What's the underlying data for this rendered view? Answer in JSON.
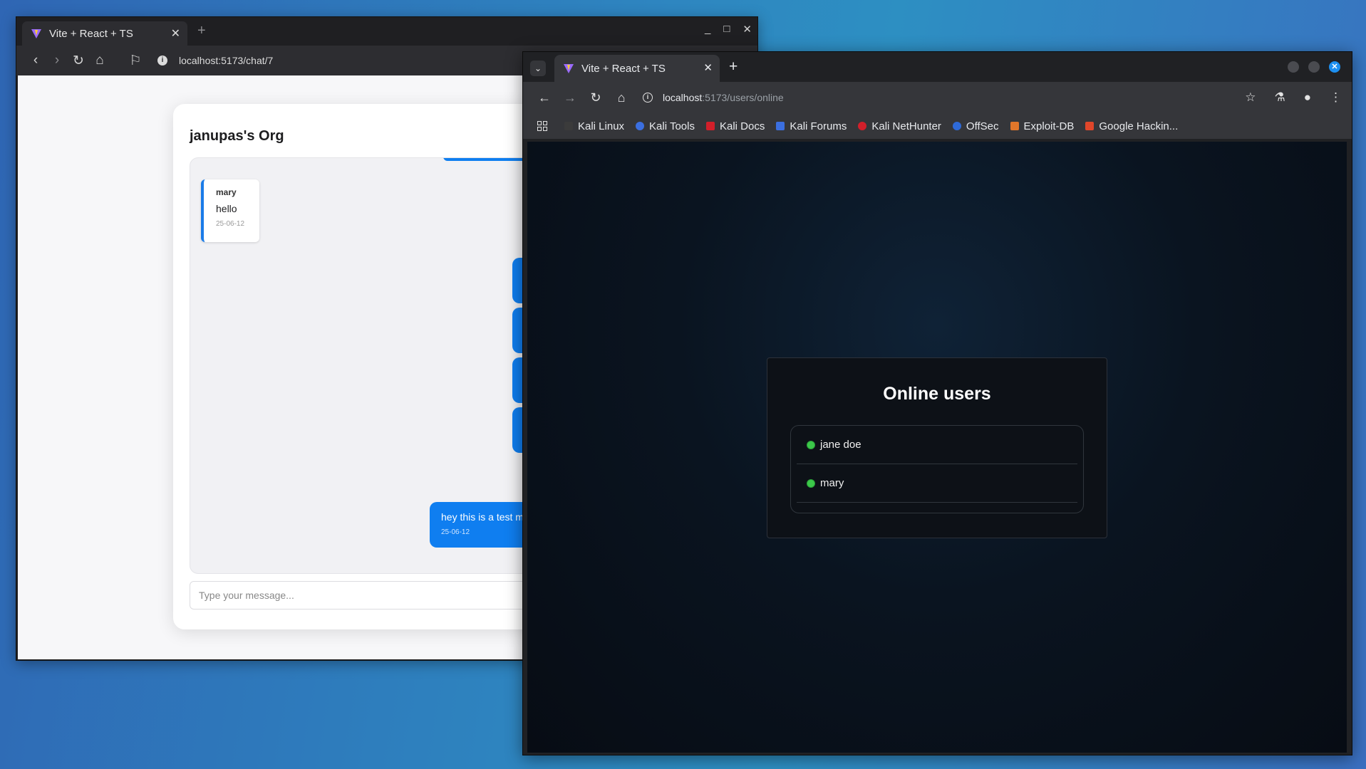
{
  "left_window": {
    "tab_title": "Vite + React + TS",
    "url": "localhost:5173/chat/7",
    "org_title": "janupas's Org",
    "incoming_message": {
      "sender": "mary",
      "text": "hello",
      "date": "25-06-12"
    },
    "outgoing_message": {
      "text": "hey this is a test m",
      "date": "25-06-12"
    },
    "input_placeholder": "Type your message..."
  },
  "right_window": {
    "tab_title": "Vite + React + TS",
    "url_host": "localhost",
    "url_path": ":5173/users/online",
    "bookmarks": [
      {
        "label": "Kali Linux",
        "color": "#3b3b3b"
      },
      {
        "label": "Kali Tools",
        "color": "#3b6fe0"
      },
      {
        "label": "Kali Docs",
        "color": "#d21f2a"
      },
      {
        "label": "Kali Forums",
        "color": "#3b6fe0"
      },
      {
        "label": "Kali NetHunter",
        "color": "#d21f2a"
      },
      {
        "label": "OffSec",
        "color": "#2e6ad8"
      },
      {
        "label": "Exploit-DB",
        "color": "#e0762a"
      },
      {
        "label": "Google Hackin...",
        "color": "#e0462a"
      }
    ],
    "panel_title": "Online users",
    "users": [
      "jane doe",
      "mary"
    ]
  }
}
